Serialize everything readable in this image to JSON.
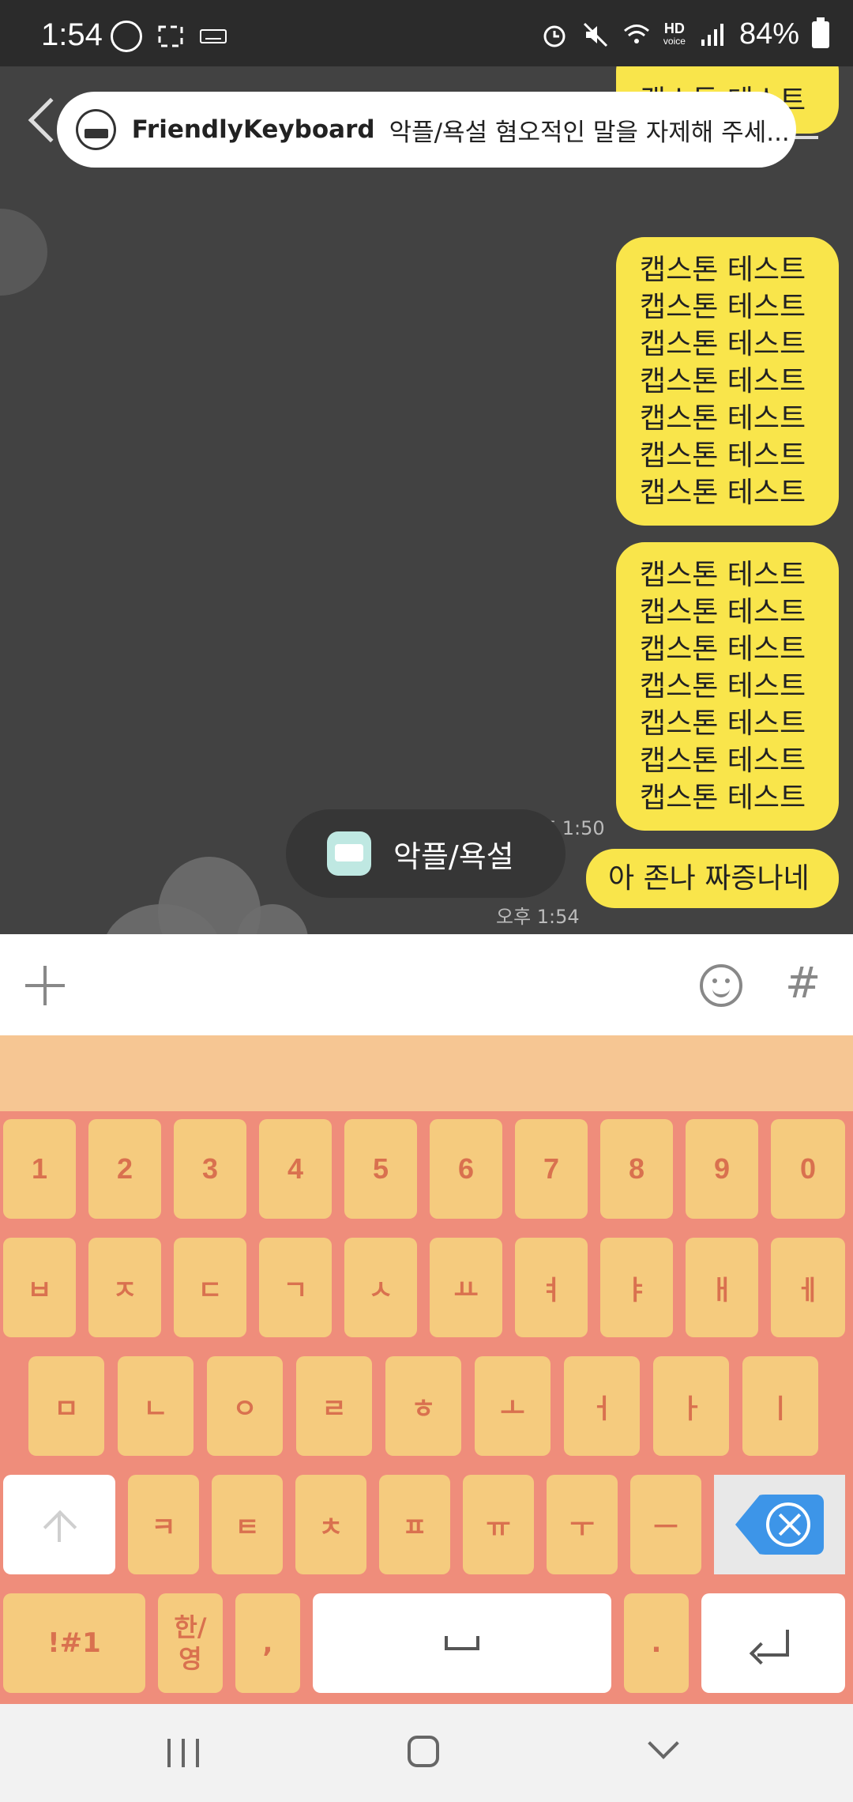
{
  "status_bar": {
    "time": "1:54",
    "battery": "84%",
    "hd_label": "HD",
    "voice_label": "voice"
  },
  "notification": {
    "app_name": "FriendlyKeyboard",
    "message": "악플/욕설 혐오적인 말을 자제해 주세..."
  },
  "chat": {
    "partial_bubble": [
      "캡스톤 테스트"
    ],
    "bubble_1": [
      "캡스톤 테스트",
      "캡스톤 테스트",
      "캡스톤 테스트",
      "캡스톤 테스트",
      "캡스톤 테스트",
      "캡스톤 테스트",
      "캡스톤 테스트"
    ],
    "bubble_2": [
      "캡스톤 테스트",
      "캡스톤 테스트",
      "캡스톤 테스트",
      "캡스톤 테스트",
      "캡스톤 테스트",
      "캡스톤 테스트",
      "캡스톤 테스트"
    ],
    "bubble_3": "아 존나 짜증나네",
    "time_1": "오후 1:50",
    "time_2": "오후 1:54"
  },
  "toast": {
    "text": "악플/욕설"
  },
  "input_bar": {
    "hash": "#"
  },
  "keyboard": {
    "row1": [
      "1",
      "2",
      "3",
      "4",
      "5",
      "6",
      "7",
      "8",
      "9",
      "0"
    ],
    "row2": [
      "ㅂ",
      "ㅈ",
      "ㄷ",
      "ㄱ",
      "ㅅ",
      "ㅛ",
      "ㅕ",
      "ㅑ",
      "ㅐ",
      "ㅔ"
    ],
    "row3": [
      "ㅁ",
      "ㄴ",
      "ㅇ",
      "ㄹ",
      "ㅎ",
      "ㅗ",
      "ㅓ",
      "ㅏ",
      "ㅣ"
    ],
    "row4": [
      "ㅋ",
      "ㅌ",
      "ㅊ",
      "ㅍ",
      "ㅠ",
      "ㅜ",
      "ㅡ"
    ],
    "symbols": "!#1",
    "lang_top": "한/",
    "lang_bottom": "영",
    "comma": ",",
    "period": "."
  }
}
